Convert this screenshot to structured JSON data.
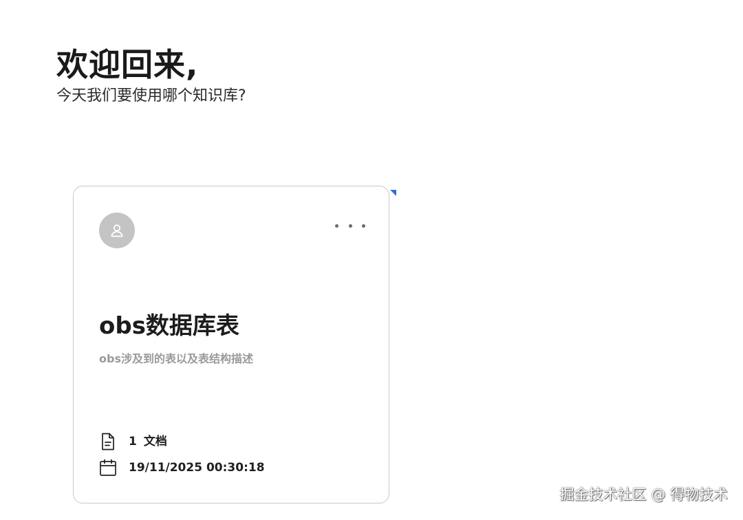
{
  "header": {
    "title": "欢迎回来,",
    "subtitle": "今天我们要使用哪个知识库?"
  },
  "knowledge_base_card": {
    "avatar_icon": "user-icon",
    "more_icon": "more-horizontal-icon",
    "title": "obs数据库表",
    "description": "obs涉及到的表以及表结构描述",
    "doc_count": "1",
    "doc_label": "文档",
    "doc_icon": "document-icon",
    "updated_at": "19/11/2025 00:30:18",
    "date_icon": "calendar-icon"
  },
  "watermark": {
    "text": "掘金技术社区 @ 得物技术"
  },
  "colors": {
    "accent_marker": "#2f6fd6",
    "avatar_bg": "#c4c4c4",
    "card_border": "#c9c9c9",
    "description_text": "#9a9a9a"
  }
}
